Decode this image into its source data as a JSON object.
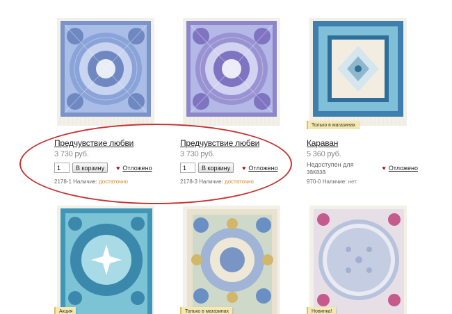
{
  "products": [
    {
      "title": "Предчувствие любви",
      "price": "3 730 руб.",
      "qty": "1",
      "cart_label": "В корзину",
      "fav_label": "Отложено",
      "article": "2178-1",
      "stock_label": "Наличие:",
      "stock_value": "достаточно",
      "scheme": "blue"
    },
    {
      "title": "Предчувствие любви",
      "price": "3 730 руб.",
      "qty": "1",
      "cart_label": "В корзину",
      "fav_label": "Отложено",
      "article": "2178-3",
      "stock_label": "Наличие:",
      "stock_value": "достаточно",
      "scheme": "violet"
    },
    {
      "title": "Караван",
      "price": "5 360 руб.",
      "unavailable": "Недоступен для заказа",
      "fav_label": "Отложено",
      "article": "970-0",
      "stock_label": "Наличие:",
      "stock_value": "нет",
      "badge": "Только в магазинах",
      "scheme": "teal"
    },
    {
      "badge": "Акция",
      "scheme": "aqua"
    },
    {
      "badge": "Только в магазинах",
      "scheme": "cream"
    },
    {
      "badge": "Новинка!",
      "scheme": "round"
    }
  ],
  "icons": {
    "heart": "♥"
  },
  "colors": {
    "highlight_oval": "#c73434",
    "badge_bg": "#f5e9b0",
    "stock_ok": "#d08a2a"
  }
}
